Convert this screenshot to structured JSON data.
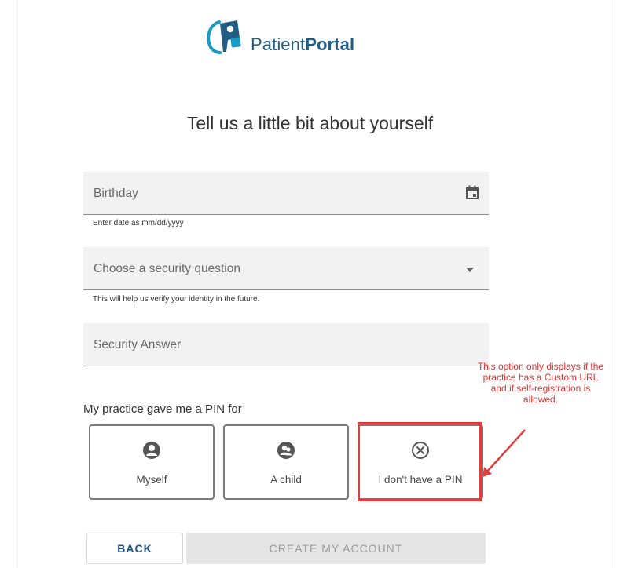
{
  "logo": {
    "word_patient": "Patient",
    "word_portal": "Portal",
    "brand_color": "#1f5d83",
    "accent_color": "#1a9bc4"
  },
  "page_title": "Tell us a little bit about yourself",
  "form": {
    "birthday": {
      "label": "Birthday",
      "hint": "Enter date as mm/dd/yyyy",
      "icon": "calendar-icon"
    },
    "security_question": {
      "label": "Choose a security question",
      "hint": "This will help us verify your identity in the future.",
      "icon": "dropdown-arrow-icon"
    },
    "security_answer": {
      "label": "Security Answer"
    }
  },
  "pin_section": {
    "label": "My practice gave me a PIN for",
    "options": [
      {
        "label": "Myself",
        "icon": "person-icon"
      },
      {
        "label": "A child",
        "icon": "people-icon"
      },
      {
        "label": "I don't have a PIN",
        "icon": "circle-x-icon"
      }
    ]
  },
  "annotation": {
    "text": "This option only displays if the practice has a Custom URL and if self-registration is allowed.",
    "color": "#e33030"
  },
  "buttons": {
    "back": "BACK",
    "create": "CREATE MY ACCOUNT"
  }
}
